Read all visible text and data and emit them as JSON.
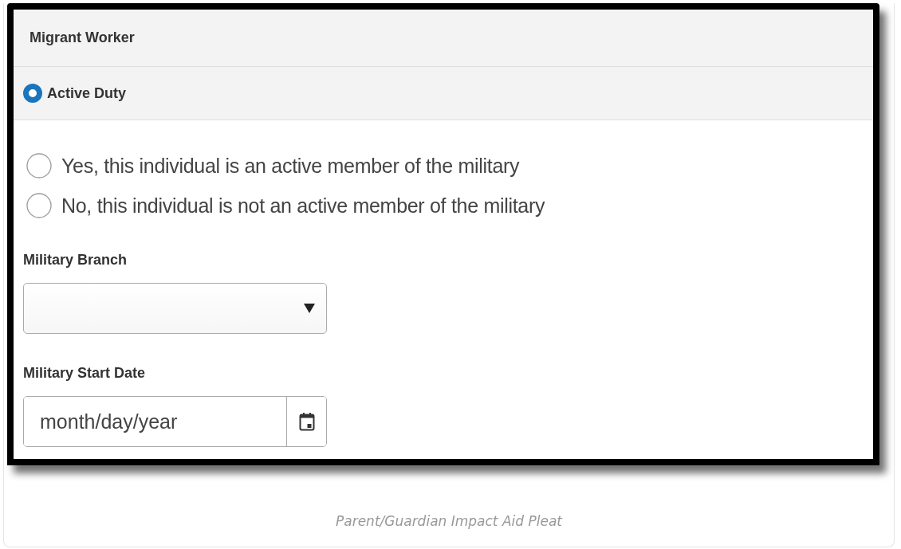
{
  "sections": [
    {
      "kind": "plain",
      "label": "Migrant Worker"
    },
    {
      "kind": "radio",
      "label": "Active Duty",
      "selected": true
    }
  ],
  "options": [
    {
      "label": "Yes, this individual is an active member of the military",
      "selected": false
    },
    {
      "label": "No, this individual is not an active member of the military",
      "selected": false
    }
  ],
  "fields": [
    {
      "kind": "select",
      "label": "Military Branch"
    },
    {
      "kind": "date",
      "label": "Military Start Date",
      "placeholder": "month/day/year"
    }
  ],
  "caption": "Parent/Guardian Impact Aid Pleat"
}
